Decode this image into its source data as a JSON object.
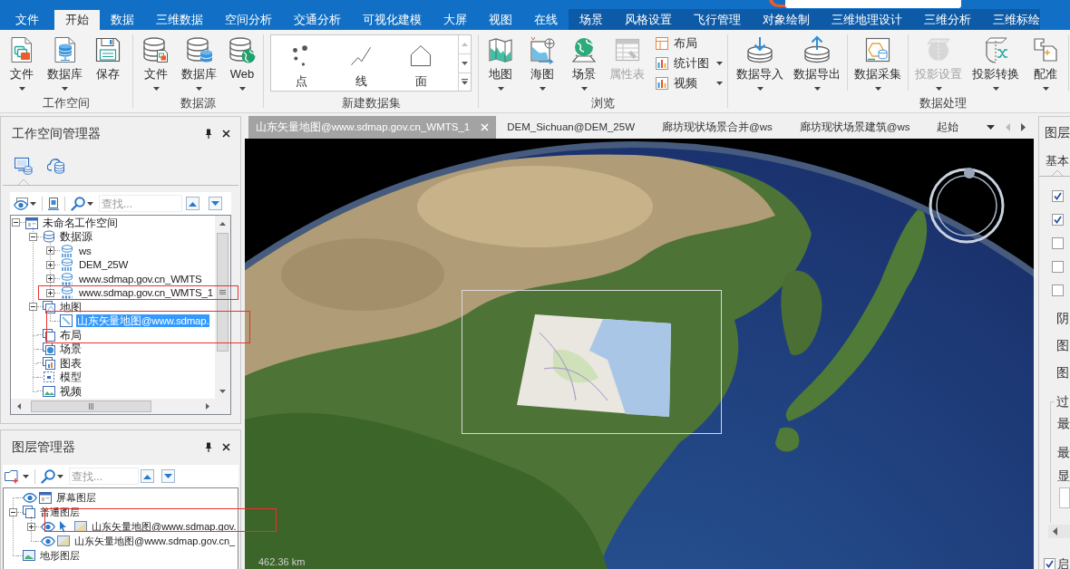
{
  "ribbon": {
    "tabs": [
      {
        "label": "文件",
        "selected": false
      },
      {
        "label": "开始",
        "selected": true
      },
      {
        "label": "数据",
        "selected": false
      },
      {
        "label": "三维数据",
        "selected": false
      },
      {
        "label": "空间分析",
        "selected": false
      },
      {
        "label": "交通分析",
        "selected": false
      },
      {
        "label": "可视化建模",
        "selected": false
      },
      {
        "label": "大屏",
        "selected": false
      },
      {
        "label": "视图",
        "selected": false
      },
      {
        "label": "在线",
        "selected": false
      }
    ],
    "context_tabs": [
      {
        "label": "场景",
        "selected": false
      },
      {
        "label": "风格设置",
        "selected": false
      },
      {
        "label": "飞行管理",
        "selected": false
      },
      {
        "label": "对象绘制",
        "selected": false
      },
      {
        "label": "三维地理设计",
        "selected": false
      },
      {
        "label": "三维分析",
        "selected": false
      },
      {
        "label": "三维标绘",
        "selected": false
      }
    ],
    "groups": [
      {
        "label": "工作空间",
        "items": [
          {
            "kind": "button",
            "label": "文件",
            "dropdown": true,
            "disabled": false
          },
          {
            "kind": "button",
            "label": "数据库",
            "dropdown": true,
            "disabled": false
          },
          {
            "kind": "button",
            "label": "保存",
            "dropdown": false,
            "disabled": false
          }
        ]
      },
      {
        "label": "数据源",
        "items": [
          {
            "kind": "button",
            "label": "文件",
            "dropdown": true,
            "disabled": false
          },
          {
            "kind": "button",
            "label": "数据库",
            "dropdown": true,
            "disabled": false
          },
          {
            "kind": "button",
            "label": "Web",
            "dropdown": true,
            "disabled": false
          }
        ]
      },
      {
        "label": "新建数据集",
        "items": [
          {
            "kind": "gallery",
            "options": [
              {
                "label": "点"
              },
              {
                "label": "线"
              },
              {
                "label": "面"
              }
            ]
          }
        ]
      },
      {
        "label": "浏览",
        "items": [
          {
            "kind": "button",
            "label": "地图",
            "dropdown": true,
            "disabled": false
          },
          {
            "kind": "button",
            "label": "海图",
            "dropdown": true,
            "disabled": false
          },
          {
            "kind": "button",
            "label": "场景",
            "dropdown": true,
            "disabled": false
          },
          {
            "kind": "button",
            "label": "属性表",
            "dropdown": false,
            "disabled": true
          },
          {
            "kind": "stack",
            "buttons": [
              {
                "label": "布局",
                "dropdown": false,
                "disabled": false
              },
              {
                "label": "统计图",
                "dropdown": true,
                "disabled": false
              },
              {
                "label": "视频",
                "dropdown": true,
                "disabled": false
              }
            ]
          }
        ]
      },
      {
        "label": "数据处理",
        "items": [
          {
            "kind": "button",
            "label": "数据导入",
            "dropdown": true,
            "disabled": false
          },
          {
            "kind": "button",
            "label": "数据导出",
            "dropdown": true,
            "disabled": false
          },
          {
            "kind": "divider"
          },
          {
            "kind": "button",
            "label": "数据采集",
            "dropdown": true,
            "disabled": false
          },
          {
            "kind": "divider"
          },
          {
            "kind": "button",
            "label": "投影设置",
            "dropdown": true,
            "disabled": true
          },
          {
            "kind": "button",
            "label": "投影转换",
            "dropdown": true,
            "disabled": false
          },
          {
            "kind": "button",
            "label": "配准",
            "dropdown": true,
            "disabled": false
          },
          {
            "kind": "divider"
          }
        ]
      }
    ]
  },
  "workspace_manager": {
    "title": "工作空间管理器",
    "view_tabs": [
      {
        "selected": true
      },
      {
        "selected": false
      }
    ],
    "search": {
      "placeholder": "查找..."
    },
    "tree": [
      {
        "label": "未命名工作空间",
        "kind": "workspace",
        "expanded": true,
        "selected": false,
        "children": [
          {
            "label": "数据源",
            "kind": "datasources",
            "expanded": true,
            "selected": false,
            "children": [
              {
                "label": "ws",
                "kind": "udb",
                "expanded": false,
                "selected": false
              },
              {
                "label": "DEM_25W",
                "kind": "udb",
                "expanded": false,
                "selected": false
              },
              {
                "label": "www.sdmap.gov.cn_WMTS",
                "kind": "ogc",
                "expanded": false,
                "selected": false
              },
              {
                "label": "www.sdmap.gov.cn_WMTS_1",
                "kind": "ogc",
                "expanded": false,
                "selected": false
              }
            ]
          },
          {
            "label": "地图",
            "kind": "maps",
            "expanded": true,
            "selected": false,
            "children": [
              {
                "label": "山东矢量地图@www.sdmap.",
                "kind": "map",
                "selected": true
              }
            ]
          },
          {
            "label": "布局",
            "kind": "layouts",
            "selected": false
          },
          {
            "label": "场景",
            "kind": "scenes",
            "selected": false
          },
          {
            "label": "图表",
            "kind": "charts",
            "selected": false
          },
          {
            "label": "模型",
            "kind": "models",
            "selected": false
          },
          {
            "label": "视频",
            "kind": "videos",
            "selected": false
          }
        ]
      }
    ]
  },
  "layer_manager": {
    "title": "图层管理器",
    "search": {
      "placeholder": "查找..."
    },
    "tree": [
      {
        "label": "屏幕图层",
        "kind": "screen",
        "visible": true
      },
      {
        "label": "普通图层",
        "kind": "group",
        "expanded": true,
        "children": [
          {
            "label": "山东矢量地图@www.sdmap.gov.",
            "kind": "layer",
            "visible": true,
            "selectable": true,
            "expanded": false
          },
          {
            "label": "山东矢量地图@www.sdmap.gov.cn_",
            "kind": "layer",
            "visible": true,
            "selectable": false
          }
        ]
      },
      {
        "label": "地形图层",
        "kind": "terrain"
      }
    ]
  },
  "map_tabs": {
    "tabs": [
      {
        "label": "山东矢量地图@www.sdmap.gov.cn_WMTS_1",
        "selected": true
      },
      {
        "label": "DEM_Sichuan@DEM_25W",
        "selected": false
      },
      {
        "label": "廊坊现状场景合并@ws",
        "selected": false
      },
      {
        "label": "廊坊现状场景建筑@ws",
        "selected": false
      },
      {
        "label": "起始",
        "selected": false
      }
    ]
  },
  "map_view": {
    "scale": "462.36 km"
  },
  "layer_properties": {
    "title": "图层",
    "tabs": [
      {
        "label": "基本",
        "selected": true
      }
    ],
    "checkboxes": [
      {
        "checked": true
      },
      {
        "checked": true
      },
      {
        "checked": false
      },
      {
        "checked": false
      },
      {
        "checked": false
      }
    ],
    "labels": [
      "阴",
      "图",
      "图"
    ],
    "group_box": {
      "title": "过",
      "labels": [
        "最",
        "最",
        "显"
      ]
    },
    "footer_checkbox": {
      "label": "启",
      "checked": true
    }
  }
}
